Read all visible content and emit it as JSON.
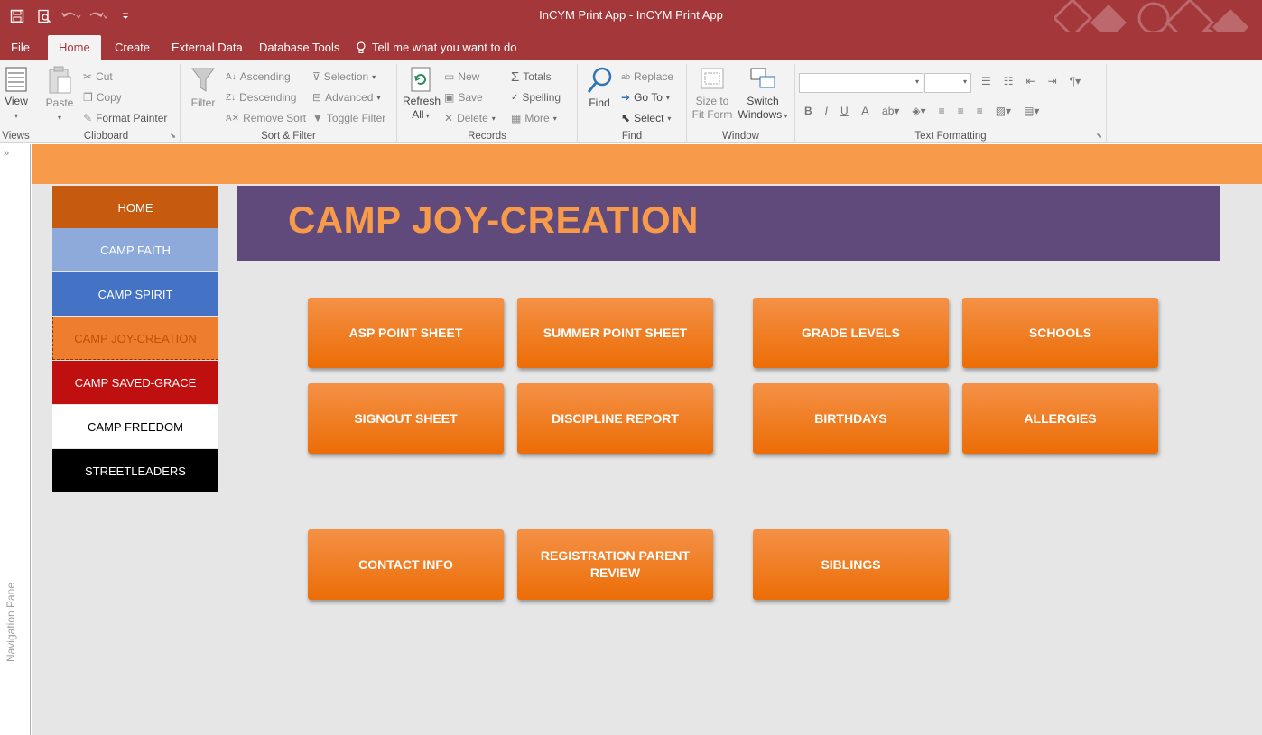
{
  "window": {
    "title": "InCYM Print App  -  InCYM Print App"
  },
  "tabs": [
    {
      "label": "File"
    },
    {
      "label": "Home"
    },
    {
      "label": "Create"
    },
    {
      "label": "External Data"
    },
    {
      "label": "Database Tools"
    }
  ],
  "tell_me": "Tell me what you want to do",
  "ribbon": {
    "views": {
      "view": "View",
      "group": "Views"
    },
    "clipboard": {
      "paste": "Paste",
      "cut": "Cut",
      "copy": "Copy",
      "format_painter": "Format Painter",
      "group": "Clipboard"
    },
    "sort_filter": {
      "filter": "Filter",
      "ascending": "Ascending",
      "descending": "Descending",
      "remove_sort": "Remove Sort",
      "selection": "Selection",
      "advanced": "Advanced",
      "toggle_filter": "Toggle Filter",
      "group": "Sort & Filter"
    },
    "records": {
      "refresh": "Refresh",
      "refresh_all": "All",
      "new": "New",
      "save": "Save",
      "delete": "Delete",
      "totals": "Totals",
      "spelling": "Spelling",
      "more": "More",
      "group": "Records"
    },
    "find": {
      "find": "Find",
      "replace": "Replace",
      "goto": "Go To",
      "select": "Select",
      "group": "Find"
    },
    "window": {
      "size_to_fit_1": "Size to",
      "size_to_fit_2": "Fit Form",
      "switch_1": "Switch",
      "switch_2": "Windows",
      "group": "Window"
    },
    "text_formatting": {
      "bold": "B",
      "italic": "I",
      "underline": "U",
      "font_color": "A",
      "group": "Text Formatting"
    }
  },
  "nav_pane": {
    "label": "Navigation Pane",
    "chevron": "»"
  },
  "menu": [
    {
      "label": "HOME"
    },
    {
      "label": "CAMP FAITH"
    },
    {
      "label": "CAMP SPIRIT"
    },
    {
      "label": "CAMP JOY-CREATION"
    },
    {
      "label": "CAMP SAVED-GRACE"
    },
    {
      "label": "CAMP FREEDOM"
    },
    {
      "label": "STREETLEADERS"
    }
  ],
  "banner_title": "CAMP JOY-CREATION",
  "actions": [
    {
      "label": "ASP POINT SHEET"
    },
    {
      "label": "SUMMER POINT SHEET"
    },
    {
      "label": "GRADE LEVELS"
    },
    {
      "label": "SCHOOLS"
    },
    {
      "label": "SIGNOUT SHEET"
    },
    {
      "label": "DISCIPLINE REPORT"
    },
    {
      "label": "BIRTHDAYS"
    },
    {
      "label": "ALLERGIES"
    },
    {
      "label": "CONTACT INFO"
    },
    {
      "label": "REGISTRATION PARENT REVIEW"
    },
    {
      "label": "SIBLINGS"
    }
  ],
  "colors": {
    "title_bar": "#a4373a",
    "form_header": "#f79b4a",
    "banner": "#604a7b",
    "button_orange": "#ec6d06"
  }
}
